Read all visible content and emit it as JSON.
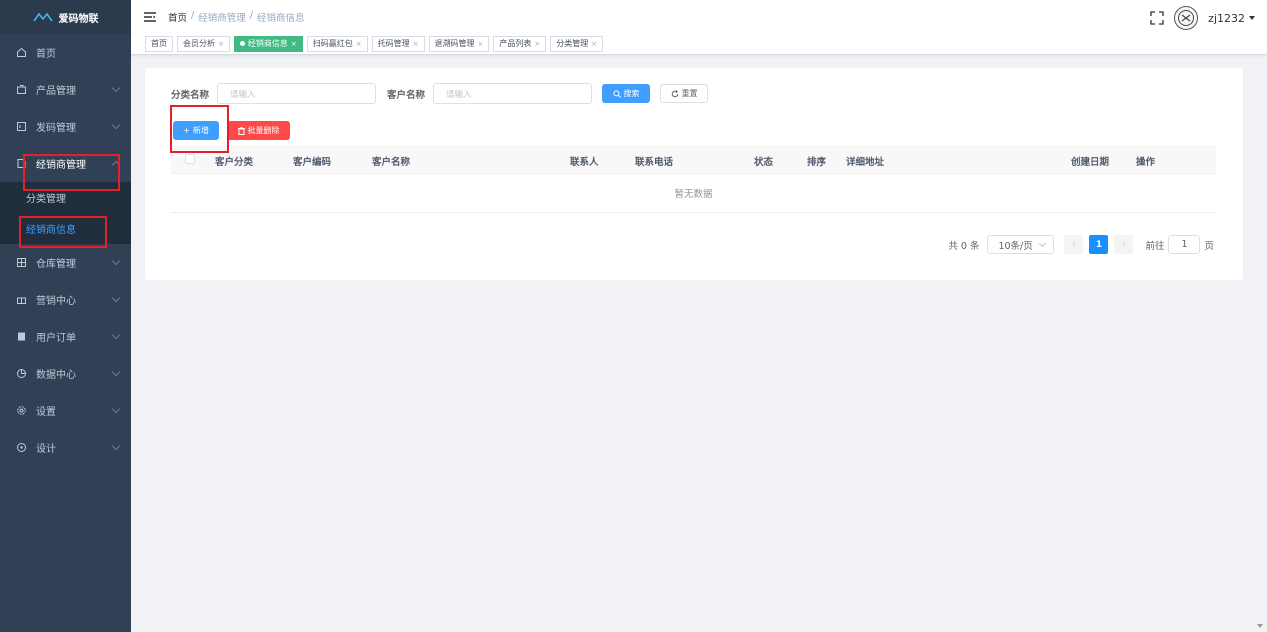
{
  "app": {
    "logo_text": "爱码物联"
  },
  "sidebar": {
    "items": [
      {
        "label": "首页",
        "icon": "home-icon"
      },
      {
        "label": "产品管理",
        "icon": "box-icon"
      },
      {
        "label": "发码管理",
        "icon": "code-icon"
      },
      {
        "label": "经销商管理",
        "icon": "document-icon",
        "open": true
      },
      {
        "label": "仓库管理",
        "icon": "warehouse-icon"
      },
      {
        "label": "营销中心",
        "icon": "gift-icon"
      },
      {
        "label": "用户订单",
        "icon": "order-icon"
      },
      {
        "label": "数据中心",
        "icon": "chart-icon"
      },
      {
        "label": "设置",
        "icon": "gear-icon"
      },
      {
        "label": "设计",
        "icon": "palette-icon"
      }
    ],
    "sub_items": [
      {
        "label": "分类管理",
        "active": false
      },
      {
        "label": "经销商信息",
        "active": true
      }
    ]
  },
  "header": {
    "breadcrumb": [
      "首页",
      "/",
      "经销商管理",
      "/",
      "经销商信息"
    ],
    "username": "zj1232"
  },
  "tags": [
    {
      "label": "首页",
      "closable": false,
      "active": false
    },
    {
      "label": "会员分析",
      "closable": true,
      "active": false
    },
    {
      "label": "经销商信息",
      "closable": true,
      "active": true
    },
    {
      "label": "扫码赢红包",
      "closable": true,
      "active": false
    },
    {
      "label": "托码管理",
      "closable": true,
      "active": false
    },
    {
      "label": "退溯码管理",
      "closable": true,
      "active": false
    },
    {
      "label": "产品列表",
      "closable": true,
      "active": false
    },
    {
      "label": "分类管理",
      "closable": true,
      "active": false
    }
  ],
  "search": {
    "category_label": "分类名称",
    "category_placeholder": "请输入",
    "customer_label": "客户名称",
    "customer_placeholder": "请输入",
    "search_button": "搜索",
    "reset_button": "重置"
  },
  "actions": {
    "add_button": "新增",
    "batch_delete_button": "批量删除"
  },
  "table": {
    "columns": [
      "客户分类",
      "客户编码",
      "客户名称",
      "联系人",
      "联系电话",
      "状态",
      "排序",
      "详细地址",
      "创建日期",
      "操作"
    ],
    "empty_text": "暂无数据"
  },
  "pagination": {
    "total_text": "共 0 条",
    "page_size": "10条/页",
    "current_page": "1",
    "goto_label": "前往",
    "goto_value": "1",
    "page_suffix": "页"
  },
  "colors": {
    "sidebar_bg": "#304156",
    "primary": "#409eff",
    "danger": "#ff4949",
    "active_tag": "#42b983",
    "annotation": "#e6202a"
  }
}
